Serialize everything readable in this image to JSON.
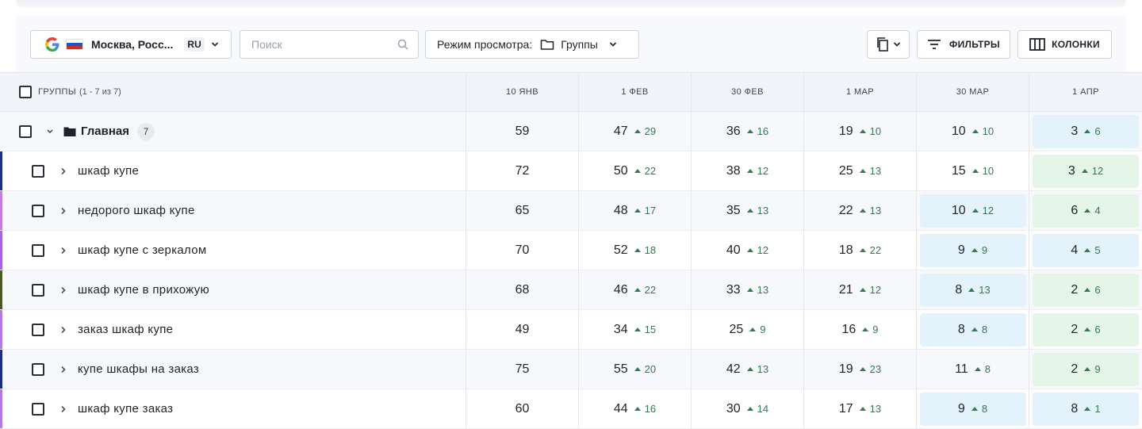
{
  "toolbar": {
    "region": {
      "name": "Москва, Росс...",
      "lang": "RU"
    },
    "search": {
      "placeholder": "Поиск",
      "value": ""
    },
    "view_mode": {
      "label": "Режим просмотра:",
      "value": "Группы"
    },
    "filters_label": "ФИЛЬТРЫ",
    "columns_label": "КОЛОНКИ"
  },
  "colors": {
    "accent_blue_cell": "#e3f2fb",
    "accent_green_cell": "#e5f5e7",
    "delta_green": "#2e7d4f",
    "flag_white": "#ffffff",
    "flag_blue": "#1c57c9",
    "flag_red": "#d52b1e"
  },
  "table": {
    "header": {
      "groups_label": "ГРУППЫ",
      "groups_range": "(1 - 7 из 7)",
      "dates": [
        "10 ЯНВ",
        "1 ФЕВ",
        "30 ФЕВ",
        "1 МАР",
        "30 МАР",
        "1 АПР"
      ]
    },
    "group_row": {
      "name": "Главная",
      "count": "7",
      "cells": [
        {
          "pos": "59",
          "delta": "",
          "hl": ""
        },
        {
          "pos": "47",
          "delta": "29",
          "hl": ""
        },
        {
          "pos": "36",
          "delta": "16",
          "hl": ""
        },
        {
          "pos": "19",
          "delta": "10",
          "hl": ""
        },
        {
          "pos": "10",
          "delta": "10",
          "hl": ""
        },
        {
          "pos": "3",
          "delta": "6",
          "hl": "blue"
        }
      ]
    },
    "rows": [
      {
        "keyword": "шкаф купе",
        "stripe": "#1d2f7a",
        "cells": [
          {
            "pos": "72",
            "delta": "",
            "hl": ""
          },
          {
            "pos": "50",
            "delta": "22",
            "hl": ""
          },
          {
            "pos": "38",
            "delta": "12",
            "hl": ""
          },
          {
            "pos": "25",
            "delta": "13",
            "hl": ""
          },
          {
            "pos": "15",
            "delta": "10",
            "hl": ""
          },
          {
            "pos": "3",
            "delta": "12",
            "hl": "green"
          }
        ]
      },
      {
        "keyword": "недорого шкаф купе",
        "stripe": "#c77ddb",
        "cells": [
          {
            "pos": "65",
            "delta": "",
            "hl": ""
          },
          {
            "pos": "48",
            "delta": "17",
            "hl": ""
          },
          {
            "pos": "35",
            "delta": "13",
            "hl": ""
          },
          {
            "pos": "22",
            "delta": "13",
            "hl": ""
          },
          {
            "pos": "10",
            "delta": "12",
            "hl": "blue"
          },
          {
            "pos": "6",
            "delta": "4",
            "hl": "green"
          }
        ]
      },
      {
        "keyword": "шкаф купе с зеркалом",
        "stripe": "#a566e0",
        "cells": [
          {
            "pos": "70",
            "delta": "",
            "hl": ""
          },
          {
            "pos": "52",
            "delta": "18",
            "hl": ""
          },
          {
            "pos": "40",
            "delta": "12",
            "hl": ""
          },
          {
            "pos": "18",
            "delta": "22",
            "hl": ""
          },
          {
            "pos": "9",
            "delta": "9",
            "hl": "blue"
          },
          {
            "pos": "4",
            "delta": "5",
            "hl": "blue"
          }
        ]
      },
      {
        "keyword": "шкаф купе в прихожую",
        "stripe": "#4b5a24",
        "cells": [
          {
            "pos": "68",
            "delta": "",
            "hl": ""
          },
          {
            "pos": "46",
            "delta": "22",
            "hl": ""
          },
          {
            "pos": "33",
            "delta": "13",
            "hl": ""
          },
          {
            "pos": "21",
            "delta": "12",
            "hl": ""
          },
          {
            "pos": "8",
            "delta": "13",
            "hl": "blue"
          },
          {
            "pos": "2",
            "delta": "6",
            "hl": "green"
          }
        ]
      },
      {
        "keyword": "заказ шкаф купе",
        "stripe": "#b47ae0",
        "cells": [
          {
            "pos": "49",
            "delta": "",
            "hl": ""
          },
          {
            "pos": "34",
            "delta": "15",
            "hl": ""
          },
          {
            "pos": "25",
            "delta": "9",
            "hl": ""
          },
          {
            "pos": "16",
            "delta": "9",
            "hl": ""
          },
          {
            "pos": "8",
            "delta": "8",
            "hl": "blue"
          },
          {
            "pos": "2",
            "delta": "6",
            "hl": "green"
          }
        ]
      },
      {
        "keyword": "купе шкафы на заказ",
        "stripe": "#1d2f7a",
        "cells": [
          {
            "pos": "75",
            "delta": "",
            "hl": ""
          },
          {
            "pos": "55",
            "delta": "20",
            "hl": ""
          },
          {
            "pos": "42",
            "delta": "13",
            "hl": ""
          },
          {
            "pos": "19",
            "delta": "23",
            "hl": ""
          },
          {
            "pos": "11",
            "delta": "8",
            "hl": ""
          },
          {
            "pos": "2",
            "delta": "9",
            "hl": "green"
          }
        ]
      },
      {
        "keyword": "шкаф купе заказ",
        "stripe": "#b47ae0",
        "cells": [
          {
            "pos": "60",
            "delta": "",
            "hl": ""
          },
          {
            "pos": "44",
            "delta": "16",
            "hl": ""
          },
          {
            "pos": "30",
            "delta": "14",
            "hl": ""
          },
          {
            "pos": "17",
            "delta": "13",
            "hl": ""
          },
          {
            "pos": "9",
            "delta": "8",
            "hl": "blue"
          },
          {
            "pos": "8",
            "delta": "1",
            "hl": "blue"
          }
        ]
      }
    ]
  }
}
